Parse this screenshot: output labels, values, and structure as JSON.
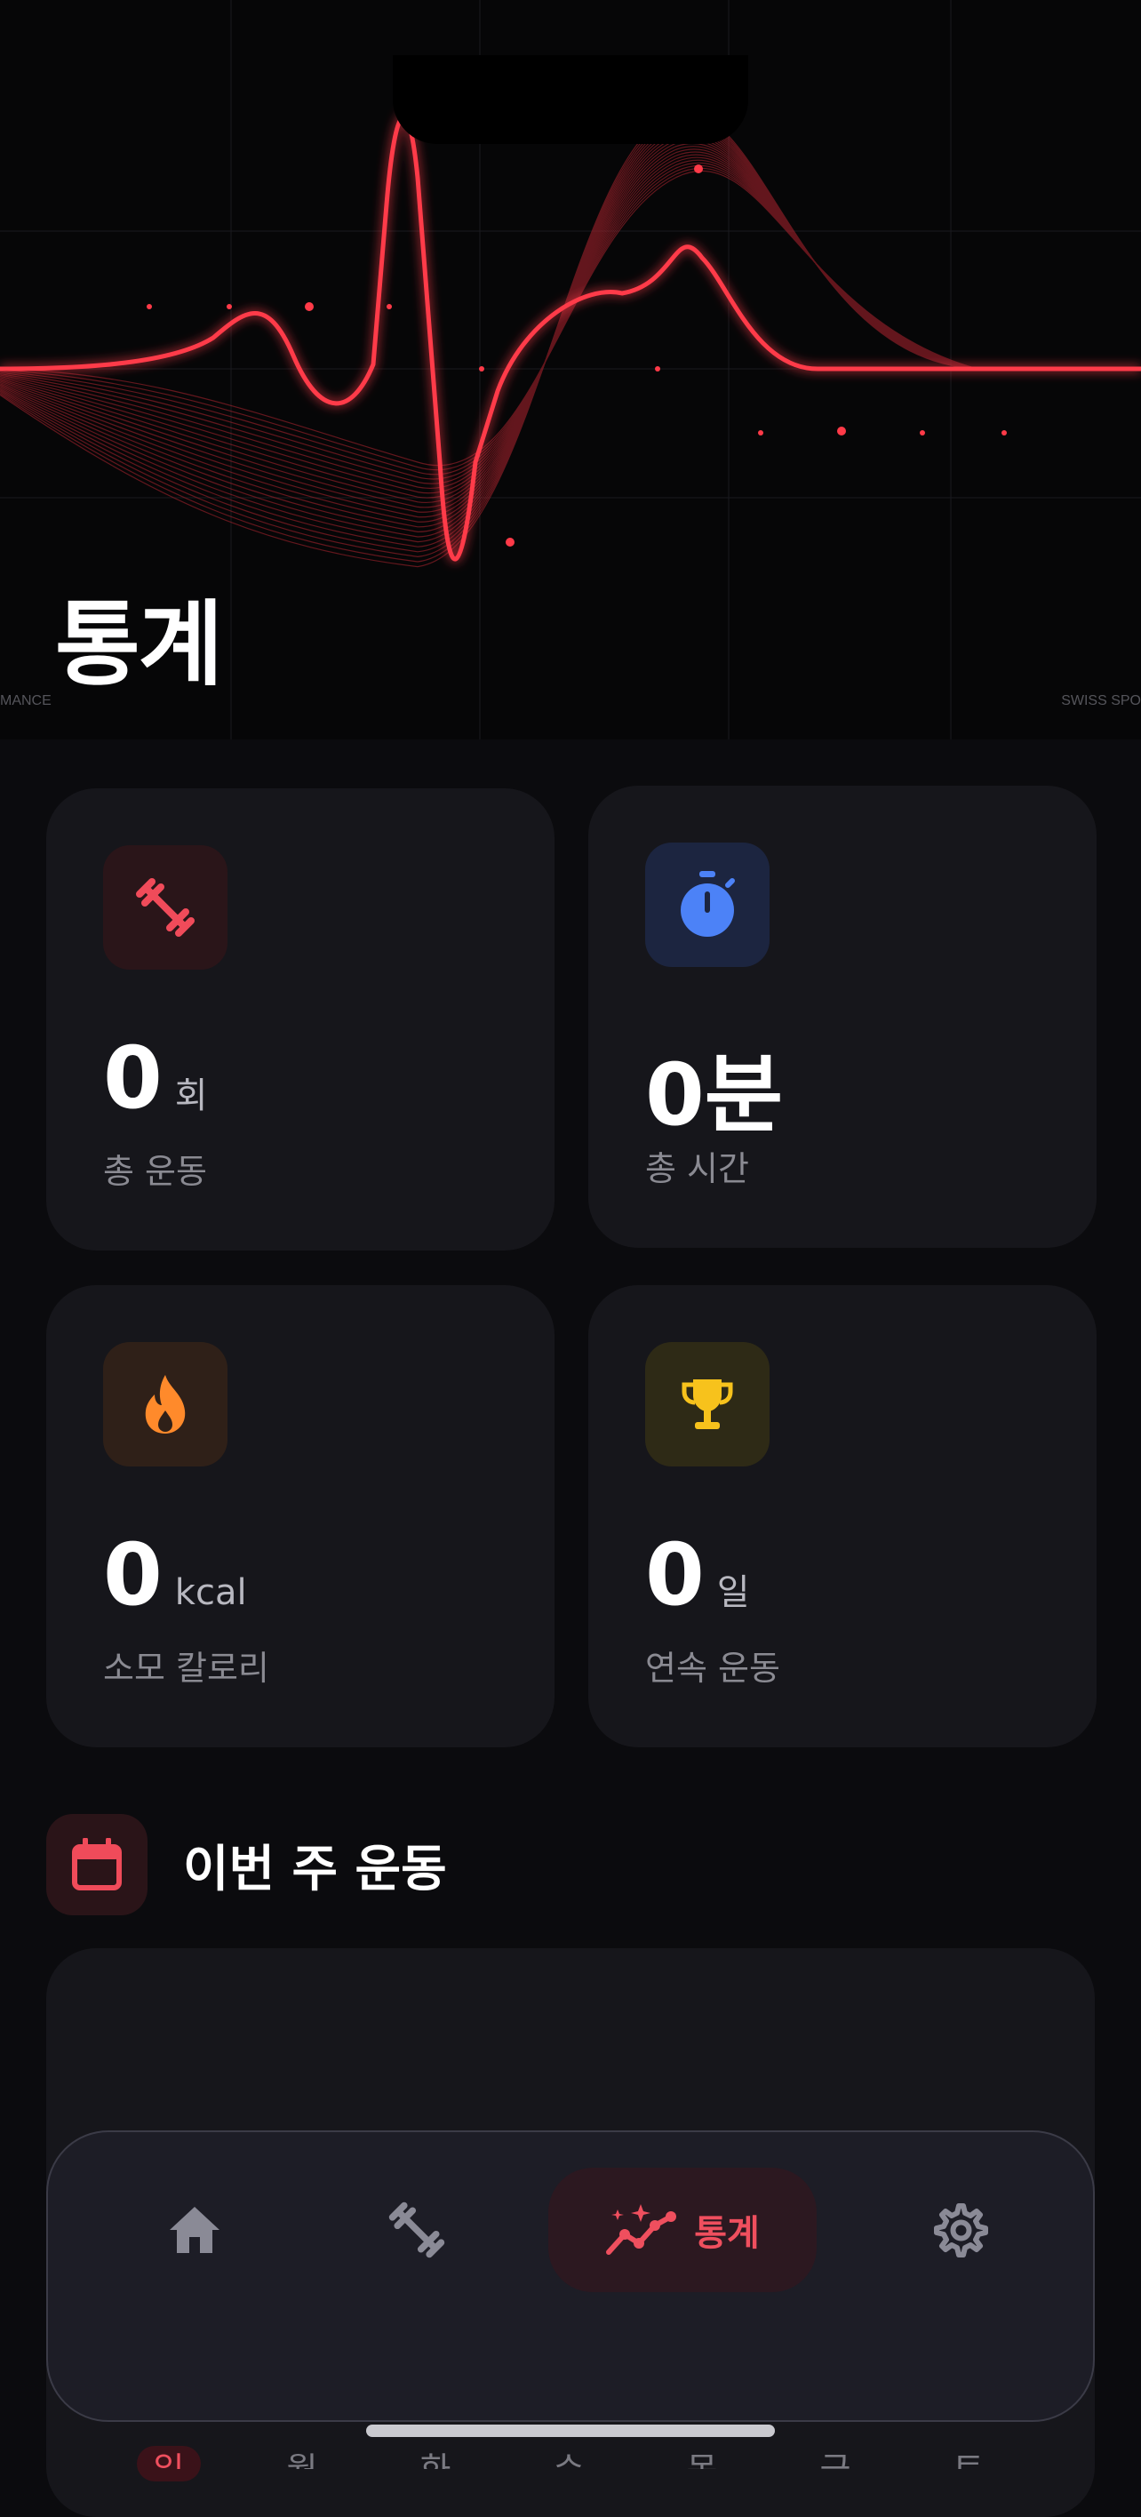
{
  "header": {
    "title": "통계",
    "caption_left": "MANCE",
    "caption_right": "SWISS SPO"
  },
  "stats": [
    {
      "id": "workouts",
      "value": "0",
      "unit": "회",
      "label": "총 운동",
      "icon": "dumbbell-icon",
      "accent": "#f04b5a"
    },
    {
      "id": "time",
      "value": "0분",
      "unit": "",
      "label": "총 시간",
      "icon": "stopwatch-icon",
      "accent": "#4c82f7"
    },
    {
      "id": "calories",
      "value": "0",
      "unit": "kcal",
      "label": "소모 칼로리",
      "icon": "flame-icon",
      "accent": "#ff8a2b"
    },
    {
      "id": "streak",
      "value": "0",
      "unit": "일",
      "label": "연속 운동",
      "icon": "trophy-icon",
      "accent": "#f7c21c"
    }
  ],
  "weekly": {
    "title": "이번 주 운동",
    "icon": "calendar-icon",
    "days": [
      "일",
      "월",
      "화",
      "수",
      "목",
      "금",
      "토"
    ],
    "today_index": 0
  },
  "tabbar": {
    "items": [
      {
        "name": "home",
        "icon": "home-icon",
        "label": ""
      },
      {
        "name": "workout",
        "icon": "dumbbell-icon",
        "label": ""
      },
      {
        "name": "stats",
        "icon": "chart-sparkle-icon",
        "label": "통계",
        "active": true
      },
      {
        "name": "settings",
        "icon": "gear-icon",
        "label": ""
      }
    ]
  },
  "colors": {
    "accent": "#ef4f5e",
    "background": "#0b0b0e",
    "card": "#16161b"
  }
}
